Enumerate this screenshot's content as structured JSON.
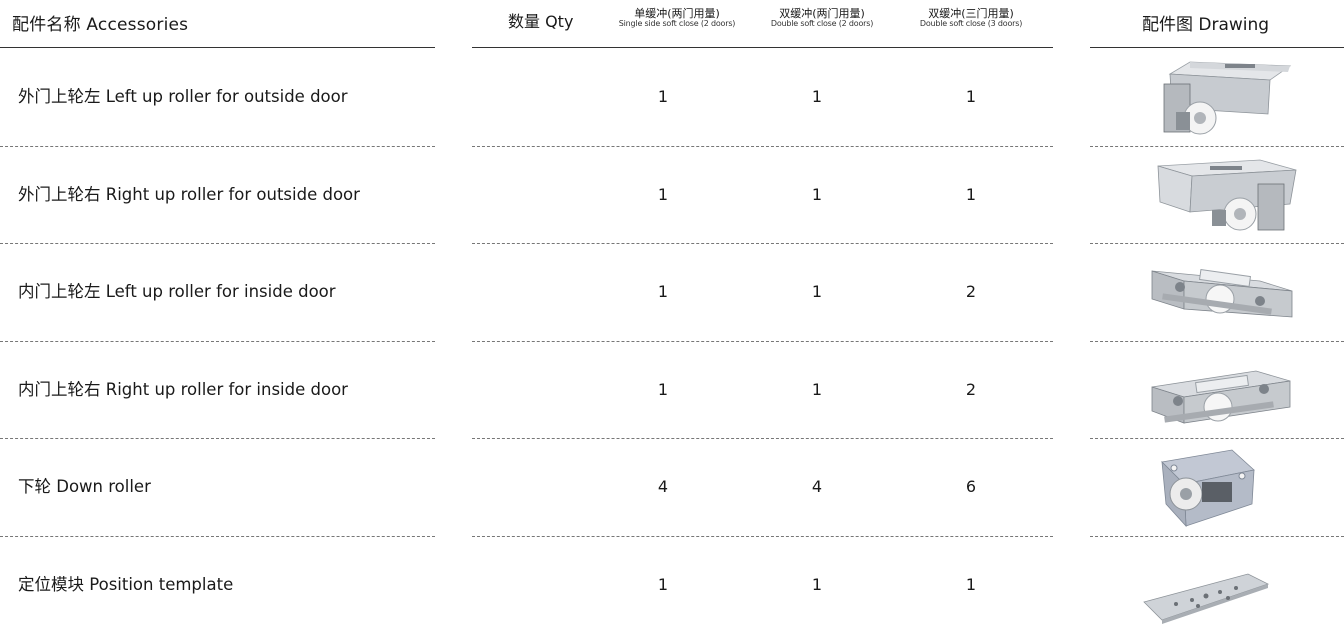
{
  "header": {
    "accessories": "配件名称  Accessories",
    "qty": "数量 Qty",
    "col1_cn": "单缓冲(两门用量)",
    "col1_en": "Single side soft close (2 doors)",
    "col2_cn": "双缓冲(两门用量)",
    "col2_en": "Double soft close (2 doors)",
    "col3_cn": "双缓冲(三门用量)",
    "col3_en": "Double soft close (3 doors)",
    "drawing": "配件图  Drawing"
  },
  "rows": [
    {
      "name": "外门上轮左 Left up roller for outside door",
      "q1": "1",
      "q2": "1",
      "q3": "1",
      "drawing": "bracket-roller-left-image"
    },
    {
      "name": "外门上轮右 Right up roller for outside door",
      "q1": "1",
      "q2": "1",
      "q3": "1",
      "drawing": "bracket-roller-right-image"
    },
    {
      "name": "内门上轮左 Left up roller for inside door",
      "q1": "1",
      "q2": "1",
      "q3": "2",
      "drawing": "flat-roller-left-image"
    },
    {
      "name": "内门上轮右 Right up roller for inside door",
      "q1": "1",
      "q2": "1",
      "q3": "2",
      "drawing": "flat-roller-right-image"
    },
    {
      "name": "下轮 Down roller",
      "q1": "4",
      "q2": "4",
      "q3": "6",
      "drawing": "down-roller-image"
    },
    {
      "name": "定位模块 Position template",
      "q1": "1",
      "q2": "1",
      "q3": "1",
      "drawing": "position-plate-image"
    }
  ]
}
